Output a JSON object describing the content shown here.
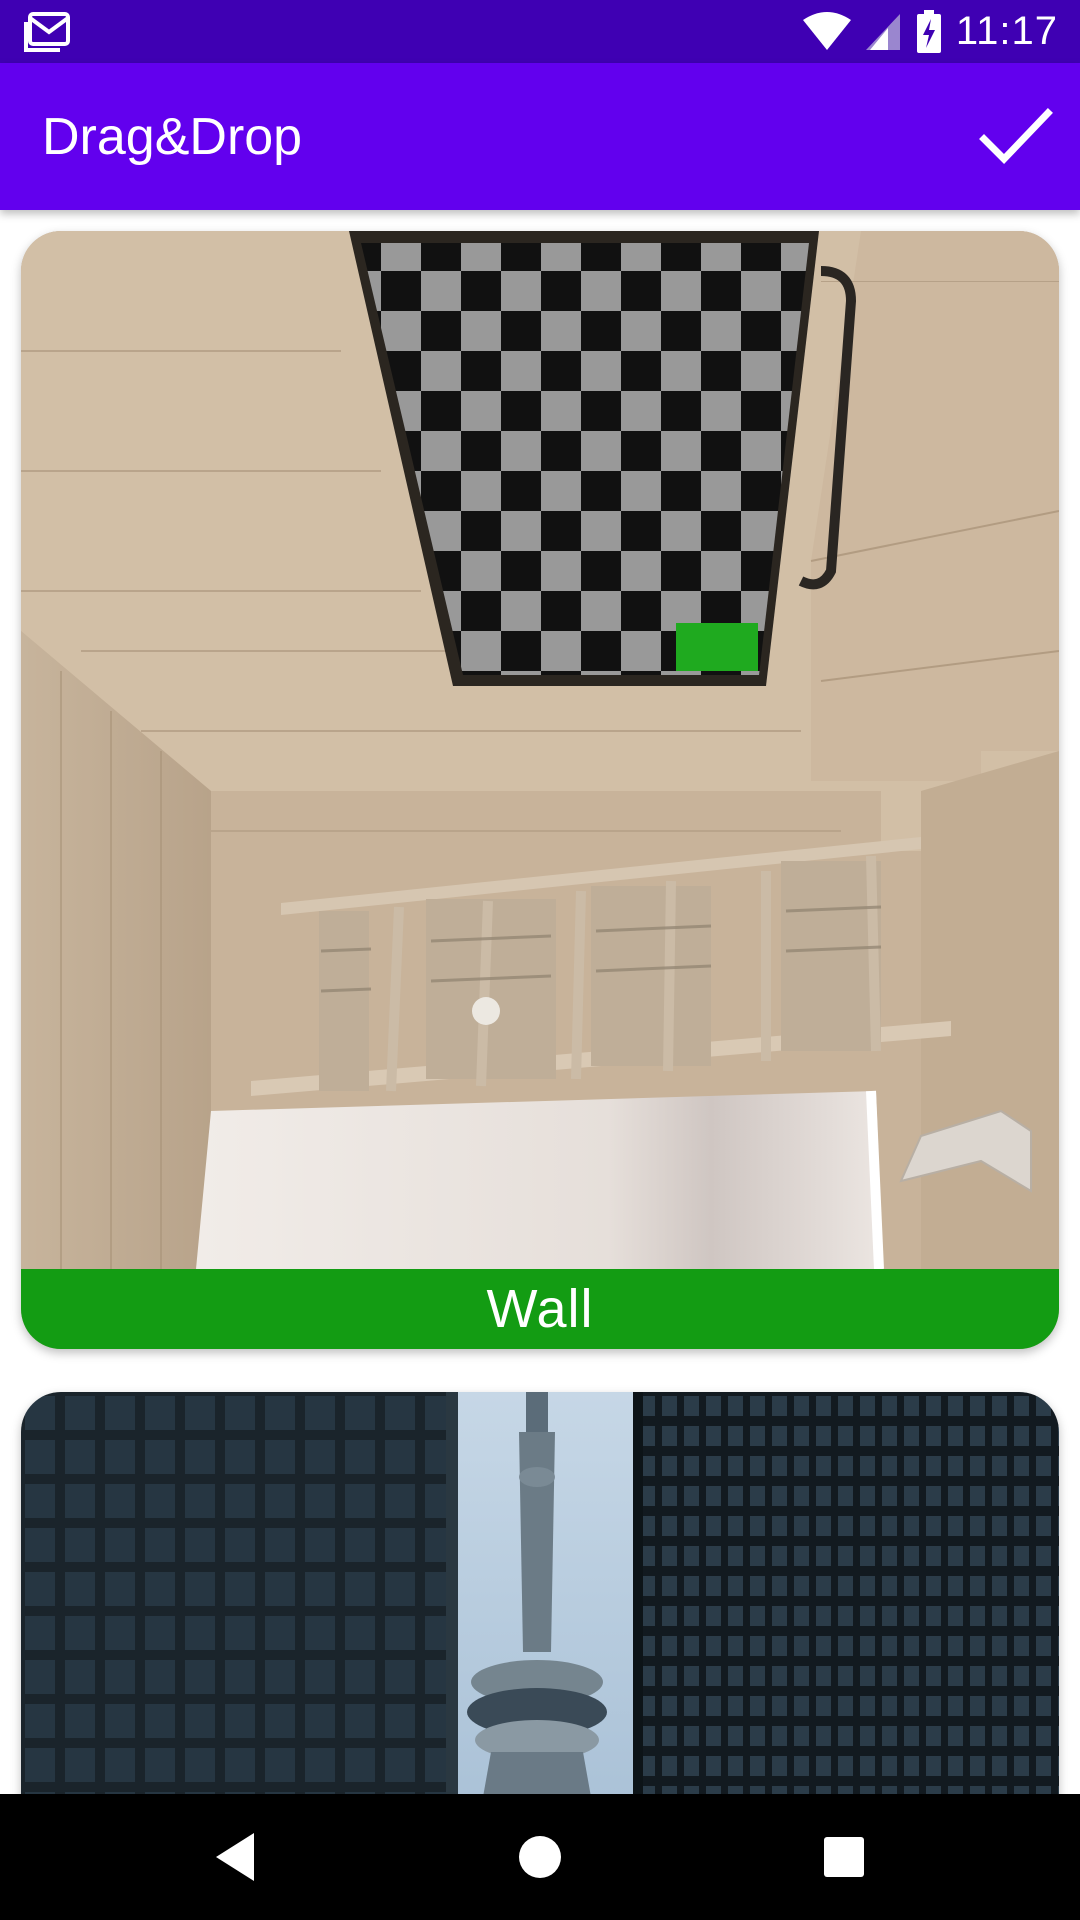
{
  "status_bar": {
    "time": "11:17",
    "icons": [
      "gmail-icon",
      "wifi-icon",
      "signal-icon",
      "battery-charging-icon"
    ]
  },
  "app_bar": {
    "title": "Drag&Drop",
    "action_icon": "check-icon"
  },
  "cards": [
    {
      "label": "Wall",
      "image": "room-with-checkerboard-ceiling-and-shelf",
      "label_color": "#139c13"
    },
    {
      "label": "",
      "image": "cn-tower-between-skyscrapers"
    }
  ],
  "nav_bar": {
    "icons": [
      "back-icon",
      "home-icon",
      "recents-icon"
    ]
  },
  "colors": {
    "status_bar": "#3f00b3",
    "app_bar": "#6200ee",
    "label_bar": "#139c13",
    "nav_bar": "#000000"
  }
}
